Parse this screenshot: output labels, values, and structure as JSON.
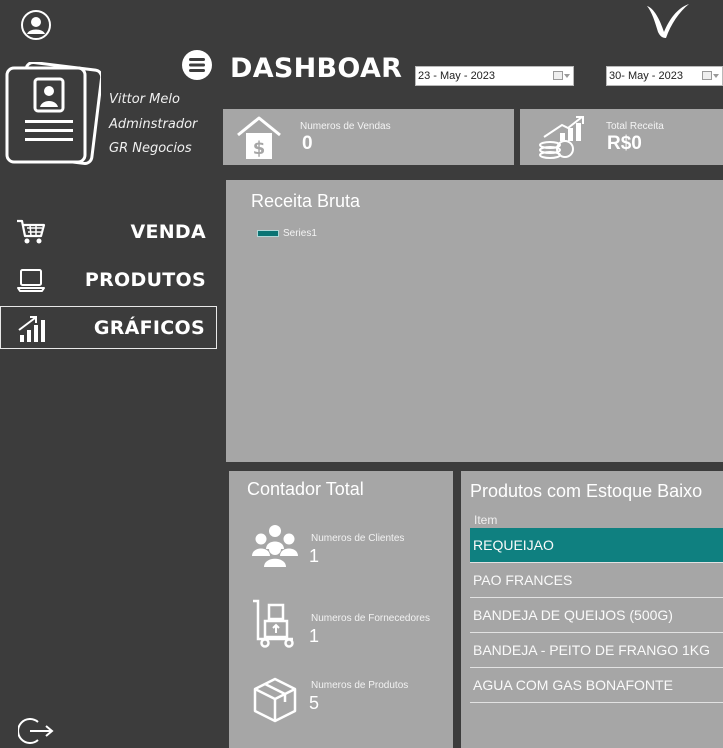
{
  "sidebar": {
    "user": {
      "name": "Vittor Melo",
      "role": "Adminstrador",
      "company": "GR Negocios"
    },
    "nav": [
      {
        "label": "VENDA",
        "icon": "cart-icon"
      },
      {
        "label": "PRODUTOS",
        "icon": "laptop-icon"
      },
      {
        "label": "GRÁFICOS",
        "icon": "bar-chart-icon",
        "active": true
      }
    ]
  },
  "header": {
    "title": "DASHBOAR",
    "date_start": "23 - May - 2023",
    "date_end": "30- May - 2023"
  },
  "stats": {
    "sales": {
      "label": "Numeros de Vendas",
      "value": "0",
      "icon": "money-house-icon"
    },
    "revenue": {
      "label": "Total Receita",
      "value": "R$0",
      "icon": "coins-growth-icon"
    }
  },
  "chart": {
    "title": "Receita Bruta",
    "legend": "Series1"
  },
  "chart_data": {
    "type": "bar",
    "title": "Receita Bruta",
    "series": [
      {
        "name": "Series1",
        "values": []
      }
    ],
    "categories": [],
    "legend": "top-left",
    "color": "#0a7373"
  },
  "counters": {
    "title": "Contador Total",
    "items": [
      {
        "label": "Numeros de Clientes",
        "value": "1",
        "icon": "people-icon"
      },
      {
        "label": "Numeros de Fornecedores",
        "value": "1",
        "icon": "hand-truck-icon"
      },
      {
        "label": "Numeros de Produtos",
        "value": "5",
        "icon": "box-icon"
      }
    ]
  },
  "low_stock": {
    "title": "Produtos com Estoque Baixo",
    "column": "Item",
    "rows": [
      "REQUEIJAO",
      "PAO FRANCES",
      "BANDEJA DE QUEIJOS (500G)",
      "BANDEJA - PEITO DE FRANGO 1KG",
      "AGUA COM GAS BONAFONTE"
    ]
  },
  "colors": {
    "background": "#3c3c3c",
    "panel": "#a6a6a6",
    "accent": "#0f8080"
  }
}
